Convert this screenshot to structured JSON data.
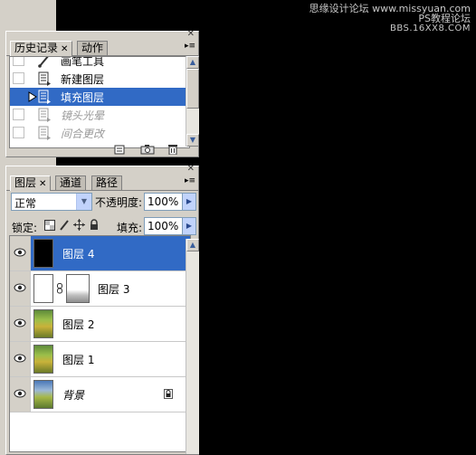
{
  "watermark": {
    "line1": "思缘设计论坛 www.missyuan.com",
    "line2": "PS教程论坛",
    "line3": "BBS.16XX8.COM"
  },
  "history_panel": {
    "tabs": [
      {
        "label": "历史记录",
        "active": true
      },
      {
        "label": "动作",
        "active": false
      }
    ],
    "items": [
      {
        "label": "画笔工具",
        "icon": "brush-icon",
        "state": "past"
      },
      {
        "label": "新建图层",
        "icon": "history-state-icon",
        "state": "past"
      },
      {
        "label": "填充图层",
        "icon": "history-state-icon",
        "state": "current"
      },
      {
        "label": "镜头光晕",
        "icon": "history-state-icon",
        "state": "future"
      },
      {
        "label": "间合更改",
        "icon": "history-state-icon",
        "state": "future"
      }
    ],
    "footer_icons": [
      "new-document-icon",
      "camera-snapshot-icon",
      "trash-icon"
    ]
  },
  "layers_panel": {
    "tabs": [
      {
        "label": "图层",
        "active": true
      },
      {
        "label": "通道",
        "active": false
      },
      {
        "label": "路径",
        "active": false
      }
    ],
    "blend_mode": "正常",
    "opacity_label": "不透明度:",
    "opacity_value": "100%",
    "lock_label": "锁定:",
    "fill_label": "填充:",
    "fill_value": "100%",
    "layers": [
      {
        "name": "图层 4",
        "thumb": "black",
        "visible": true,
        "selected": true,
        "mask": false,
        "locked": false,
        "italic": false
      },
      {
        "name": "图层 3",
        "thumb": "white",
        "visible": true,
        "selected": false,
        "mask": true,
        "locked": false,
        "italic": false
      },
      {
        "name": "图层 2",
        "thumb": "photo",
        "visible": true,
        "selected": false,
        "mask": false,
        "locked": false,
        "italic": false
      },
      {
        "name": "图层 1",
        "thumb": "photo",
        "visible": true,
        "selected": false,
        "mask": false,
        "locked": false,
        "italic": false
      },
      {
        "name": "背景",
        "thumb": "photo-blue",
        "visible": true,
        "selected": false,
        "mask": false,
        "locked": true,
        "italic": true
      }
    ]
  },
  "colors": {
    "selection": "#316ac5",
    "panel_bg": "#d4d0c8",
    "canvas_bg": "#000000"
  }
}
